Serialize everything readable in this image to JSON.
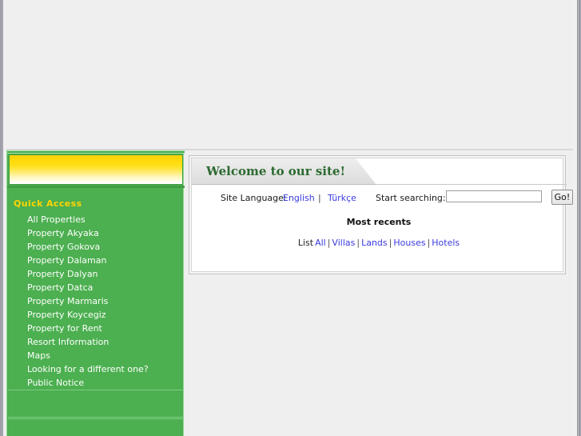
{
  "sidebar": {
    "banner": {
      "name": "yellow-gradient-banner"
    },
    "quick_access_title": "Quick Access",
    "items": [
      {
        "label": "All Properties"
      },
      {
        "label": "Property Akyaka"
      },
      {
        "label": "Property Gokova"
      },
      {
        "label": "Property Dalaman"
      },
      {
        "label": "Property Dalyan"
      },
      {
        "label": "Property Datca"
      },
      {
        "label": "Property Marmaris"
      },
      {
        "label": "Property Koycegiz"
      },
      {
        "label": "Property for Rent"
      },
      {
        "label": "Resort Information"
      },
      {
        "label": "Maps"
      },
      {
        "label": "Looking for a different one?"
      },
      {
        "label": "Public Notice"
      }
    ]
  },
  "panel": {
    "title": "Welcome to our site!",
    "language": {
      "label": "Site Language:",
      "english": "English",
      "separator": "|",
      "turkish": "Türkçe"
    },
    "search": {
      "label": "Start searching:",
      "value": "",
      "placeholder": "",
      "button": "Go!"
    },
    "recents": {
      "heading": "Most recents",
      "lead": "List",
      "links": [
        "All",
        "Villas",
        "Lands",
        "Houses",
        "Hotels"
      ],
      "separator": "|"
    }
  },
  "colors": {
    "sidebar_green": "#4caf50",
    "quick_access_gold": "#ffd400",
    "banner_gold": "#ffd90b",
    "link_blue": "#3b3be0",
    "title_green": "#2c6a2f",
    "page_gray": "#efefef"
  }
}
